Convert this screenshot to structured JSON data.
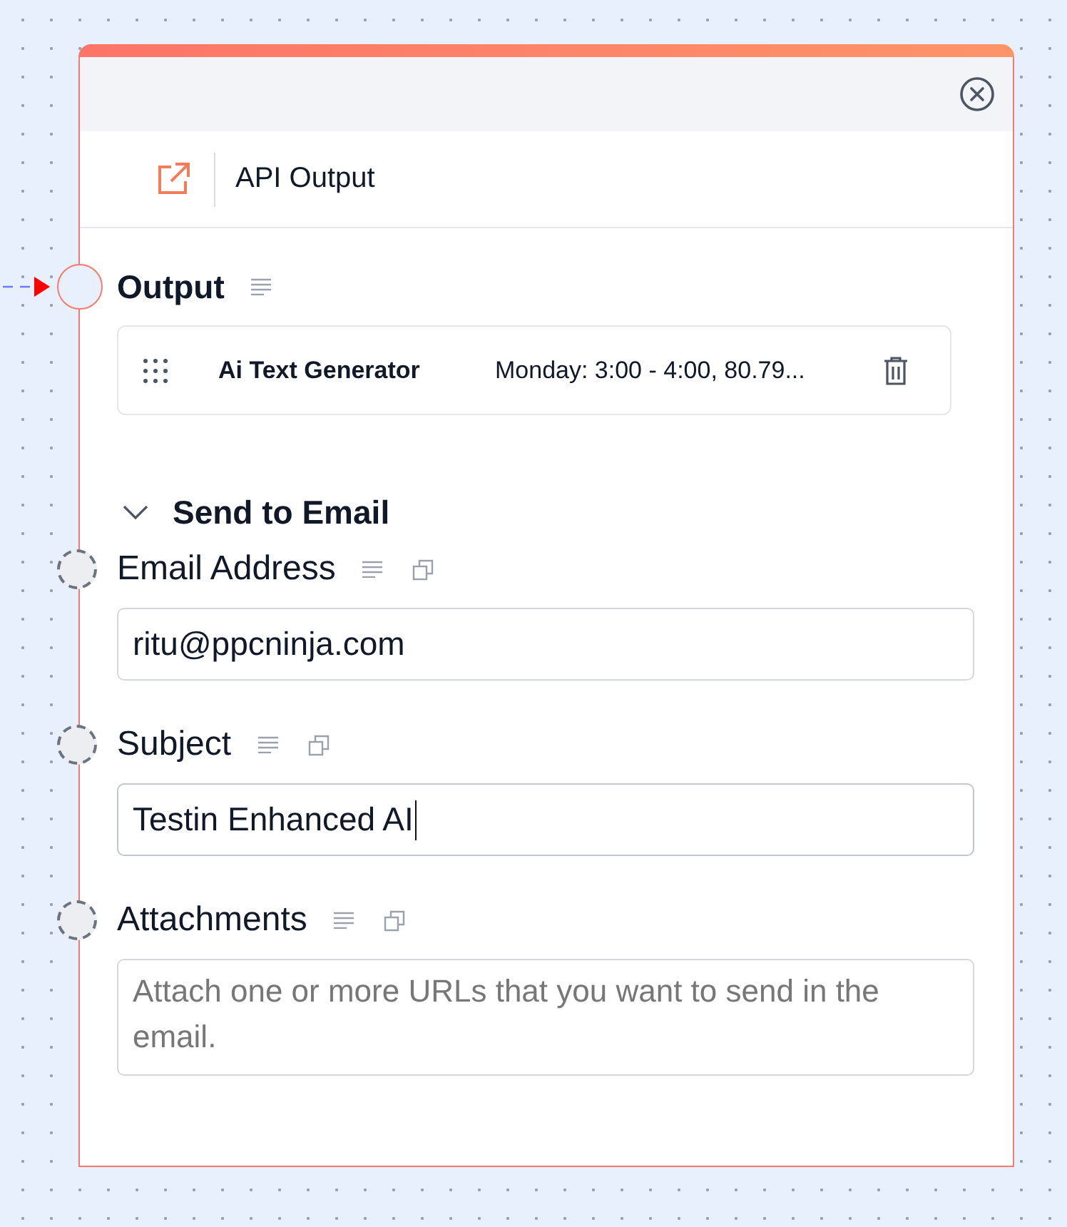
{
  "node": {
    "title": "API Output"
  },
  "output": {
    "label": "Output",
    "items": [
      {
        "name": "Ai Text Generator",
        "value": "Monday: 3:00 - 4:00, 80.79..."
      }
    ]
  },
  "section": {
    "title": "Send to Email",
    "expanded": true,
    "fields": [
      {
        "label": "Email Address",
        "value": "ritu@ppcninja.com",
        "focused": false,
        "kind": "line"
      },
      {
        "label": "Subject",
        "value": "Testin Enhanced AI",
        "focused": true,
        "kind": "line"
      },
      {
        "label": "Attachments",
        "placeholder": "Attach one or more URLs that you want to send in the email.",
        "focused": false,
        "kind": "multiline"
      }
    ]
  }
}
